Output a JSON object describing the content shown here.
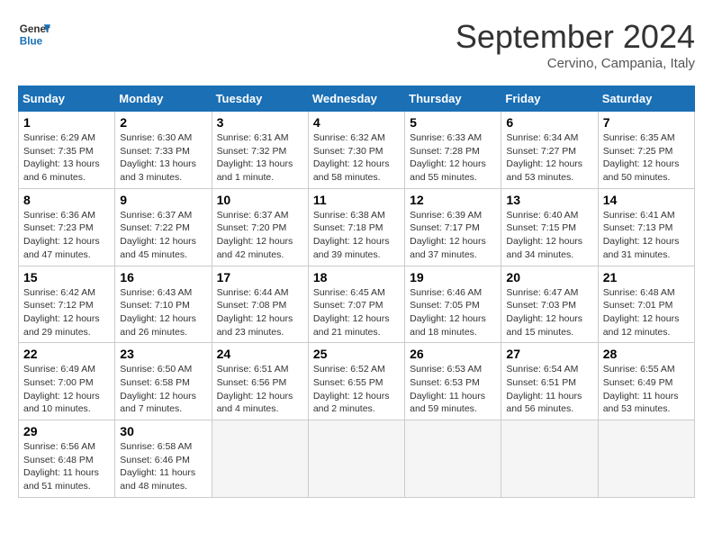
{
  "header": {
    "logo_line1": "General",
    "logo_line2": "Blue",
    "month": "September 2024",
    "location": "Cervino, Campania, Italy"
  },
  "weekdays": [
    "Sunday",
    "Monday",
    "Tuesday",
    "Wednesday",
    "Thursday",
    "Friday",
    "Saturday"
  ],
  "weeks": [
    [
      {
        "day": "1",
        "sunrise": "6:29 AM",
        "sunset": "7:35 PM",
        "daylight": "13 hours and 6 minutes."
      },
      {
        "day": "2",
        "sunrise": "6:30 AM",
        "sunset": "7:33 PM",
        "daylight": "13 hours and 3 minutes."
      },
      {
        "day": "3",
        "sunrise": "6:31 AM",
        "sunset": "7:32 PM",
        "daylight": "13 hours and 1 minute."
      },
      {
        "day": "4",
        "sunrise": "6:32 AM",
        "sunset": "7:30 PM",
        "daylight": "12 hours and 58 minutes."
      },
      {
        "day": "5",
        "sunrise": "6:33 AM",
        "sunset": "7:28 PM",
        "daylight": "12 hours and 55 minutes."
      },
      {
        "day": "6",
        "sunrise": "6:34 AM",
        "sunset": "7:27 PM",
        "daylight": "12 hours and 53 minutes."
      },
      {
        "day": "7",
        "sunrise": "6:35 AM",
        "sunset": "7:25 PM",
        "daylight": "12 hours and 50 minutes."
      }
    ],
    [
      {
        "day": "8",
        "sunrise": "6:36 AM",
        "sunset": "7:23 PM",
        "daylight": "12 hours and 47 minutes."
      },
      {
        "day": "9",
        "sunrise": "6:37 AM",
        "sunset": "7:22 PM",
        "daylight": "12 hours and 45 minutes."
      },
      {
        "day": "10",
        "sunrise": "6:37 AM",
        "sunset": "7:20 PM",
        "daylight": "12 hours and 42 minutes."
      },
      {
        "day": "11",
        "sunrise": "6:38 AM",
        "sunset": "7:18 PM",
        "daylight": "12 hours and 39 minutes."
      },
      {
        "day": "12",
        "sunrise": "6:39 AM",
        "sunset": "7:17 PM",
        "daylight": "12 hours and 37 minutes."
      },
      {
        "day": "13",
        "sunrise": "6:40 AM",
        "sunset": "7:15 PM",
        "daylight": "12 hours and 34 minutes."
      },
      {
        "day": "14",
        "sunrise": "6:41 AM",
        "sunset": "7:13 PM",
        "daylight": "12 hours and 31 minutes."
      }
    ],
    [
      {
        "day": "15",
        "sunrise": "6:42 AM",
        "sunset": "7:12 PM",
        "daylight": "12 hours and 29 minutes."
      },
      {
        "day": "16",
        "sunrise": "6:43 AM",
        "sunset": "7:10 PM",
        "daylight": "12 hours and 26 minutes."
      },
      {
        "day": "17",
        "sunrise": "6:44 AM",
        "sunset": "7:08 PM",
        "daylight": "12 hours and 23 minutes."
      },
      {
        "day": "18",
        "sunrise": "6:45 AM",
        "sunset": "7:07 PM",
        "daylight": "12 hours and 21 minutes."
      },
      {
        "day": "19",
        "sunrise": "6:46 AM",
        "sunset": "7:05 PM",
        "daylight": "12 hours and 18 minutes."
      },
      {
        "day": "20",
        "sunrise": "6:47 AM",
        "sunset": "7:03 PM",
        "daylight": "12 hours and 15 minutes."
      },
      {
        "day": "21",
        "sunrise": "6:48 AM",
        "sunset": "7:01 PM",
        "daylight": "12 hours and 12 minutes."
      }
    ],
    [
      {
        "day": "22",
        "sunrise": "6:49 AM",
        "sunset": "7:00 PM",
        "daylight": "12 hours and 10 minutes."
      },
      {
        "day": "23",
        "sunrise": "6:50 AM",
        "sunset": "6:58 PM",
        "daylight": "12 hours and 7 minutes."
      },
      {
        "day": "24",
        "sunrise": "6:51 AM",
        "sunset": "6:56 PM",
        "daylight": "12 hours and 4 minutes."
      },
      {
        "day": "25",
        "sunrise": "6:52 AM",
        "sunset": "6:55 PM",
        "daylight": "12 hours and 2 minutes."
      },
      {
        "day": "26",
        "sunrise": "6:53 AM",
        "sunset": "6:53 PM",
        "daylight": "11 hours and 59 minutes."
      },
      {
        "day": "27",
        "sunrise": "6:54 AM",
        "sunset": "6:51 PM",
        "daylight": "11 hours and 56 minutes."
      },
      {
        "day": "28",
        "sunrise": "6:55 AM",
        "sunset": "6:49 PM",
        "daylight": "11 hours and 53 minutes."
      }
    ],
    [
      {
        "day": "29",
        "sunrise": "6:56 AM",
        "sunset": "6:48 PM",
        "daylight": "11 hours and 51 minutes."
      },
      {
        "day": "30",
        "sunrise": "6:58 AM",
        "sunset": "6:46 PM",
        "daylight": "11 hours and 48 minutes."
      },
      null,
      null,
      null,
      null,
      null
    ]
  ]
}
